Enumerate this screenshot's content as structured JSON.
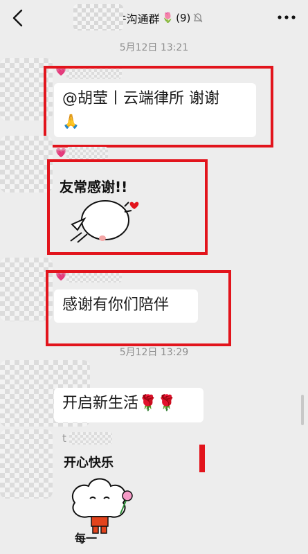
{
  "header": {
    "title": "案件沟通群",
    "title_emoji": "🌷",
    "member_count": "(9)",
    "mute_icon": "bell-mute-icon"
  },
  "timestamps": [
    "5月12日 13:21",
    "5月12日 13:29"
  ],
  "messages": [
    {
      "line1": "@胡莹丨云端律所 谢谢",
      "line2": "🙏"
    },
    {
      "sticker_text": "友常感谢!!"
    },
    {
      "text": "感谢有你们陪伴"
    },
    {
      "text": "开启新生活🌹🌹"
    },
    {
      "sender_visible": "t",
      "sticker_text_top": "开心快乐",
      "sticker_text_bottom": "每一"
    }
  ],
  "colors": {
    "highlight": "#e2141c",
    "background": "#ededed",
    "bubble": "#ffffff"
  }
}
